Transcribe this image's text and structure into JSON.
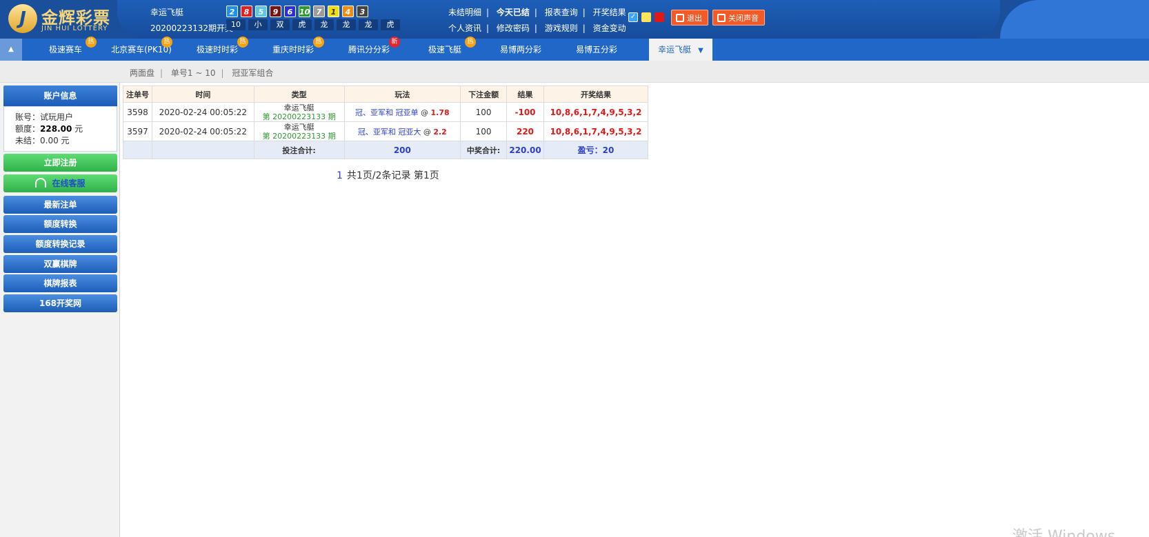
{
  "brand": {
    "logo_mark": "J",
    "name_cn": "金辉彩票",
    "name_en": "JIN HUI LOTTERY"
  },
  "draw": {
    "game": "幸运飞艇",
    "period_text": "20200223132期开奖",
    "balls": [
      "2",
      "8",
      "5",
      "9",
      "6",
      "10",
      "7",
      "1",
      "4",
      "3"
    ],
    "sums": [
      "10",
      "小",
      "双",
      "虎",
      "龙",
      "龙",
      "龙",
      "虎"
    ]
  },
  "top_links": {
    "row1": [
      "未结明细",
      "今天已结",
      "报表查询",
      "开奖结果"
    ],
    "row2": [
      "个人资讯",
      "修改密码",
      "游戏规则",
      "资金变动"
    ],
    "check": "✓"
  },
  "header_buttons": {
    "logout": "退出",
    "sound_off": "关闭声音"
  },
  "nav": {
    "tabs": [
      {
        "label": "极速赛车",
        "badge": "热"
      },
      {
        "label": "北京赛车(PK10)",
        "badge": "热"
      },
      {
        "label": "极速时时彩",
        "badge": "热"
      },
      {
        "label": "重庆时时彩",
        "badge": "热"
      },
      {
        "label": "腾讯分分彩",
        "badge": "新"
      },
      {
        "label": "极速飞艇",
        "badge": "热"
      },
      {
        "label": "易博两分彩",
        "badge": ""
      },
      {
        "label": "易博五分彩",
        "badge": ""
      }
    ],
    "active": "幸运飞艇",
    "active_caret": "▼",
    "toggle": "▲"
  },
  "subnav": [
    "两面盘",
    "单号1 ~ 10",
    "冠亚军组合"
  ],
  "account": {
    "title": "账户信息",
    "account_label": "账号：",
    "account_value": "试玩用户",
    "limit_label": "额度：",
    "limit_value": "228.00",
    "limit_unit": " 元",
    "unsettled_label": "未结：",
    "unsettled_value": "0.00 元"
  },
  "sidebar_buttons": {
    "register": "立即注册",
    "service": "在线客服",
    "latest": "最新注单",
    "transfer": "额度转换",
    "transfer_log": "额度转换记录",
    "chess": "双赢棋牌",
    "chess_report": "棋牌报表",
    "site168": "168开奖网"
  },
  "table": {
    "headers": [
      "注单号",
      "时间",
      "类型",
      "玩法",
      "下注金额",
      "结果",
      "开奖结果"
    ],
    "rows": [
      {
        "id": "3598",
        "time": "2020-02-24 00:05:22",
        "type": "幸运飞艇",
        "period": "第 20200223133 期",
        "play": "冠、亚军和 冠亚单",
        "at": " @ ",
        "odds": "1.78",
        "amount": "100",
        "result": "-100",
        "draw": "10,8,6,1,7,4,9,5,3,2"
      },
      {
        "id": "3597",
        "time": "2020-02-24 00:05:22",
        "type": "幸运飞艇",
        "period": "第 20200223133 期",
        "play": "冠、亚军和 冠亚大",
        "at": " @ ",
        "odds": "2.2",
        "amount": "100",
        "result": "220",
        "draw": "10,8,6,1,7,4,9,5,3,2"
      }
    ],
    "total": {
      "bet_label": "投注合计:",
      "bet_value": "200",
      "win_label": "中奖合计:",
      "win_value": "220.00",
      "profit": "盈亏：20"
    }
  },
  "pager": {
    "current": "1",
    "text": "共1页/2条记录 第1页"
  },
  "watermark": "激活 Windows",
  "colors": {
    "brand_blue": "#2167c8",
    "accent_red": "#e41717",
    "green": "#2fb14a"
  }
}
